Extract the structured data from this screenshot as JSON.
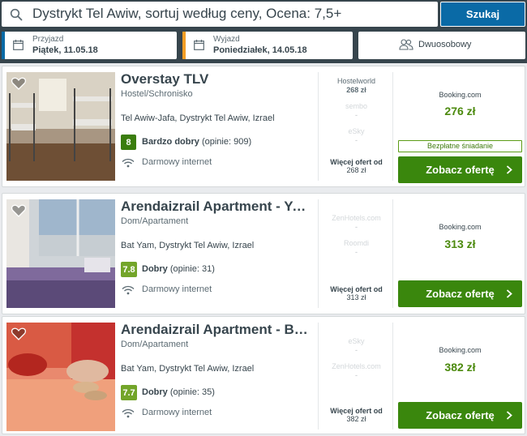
{
  "search": {
    "query": "Dystrykt Tel Awiw, sortuj według ceny, Ocena: 7,5+",
    "button": "Szukaj"
  },
  "checkin": {
    "label": "Przyjazd",
    "value": "Piątek, 11.05.18"
  },
  "checkout": {
    "label": "Wyjazd",
    "value": "Poniedziałek, 14.05.18"
  },
  "room": {
    "label": "Dwuosobowy"
  },
  "colors": {
    "accent_checkin": "#0a6aa6",
    "accent_checkout": "#f49e25",
    "deal_green": "#3a870d",
    "score_dark": "#3a7d0e",
    "score_light": "#73a52a"
  },
  "results": [
    {
      "name": "Overstay TLV",
      "type": "Hostel/Schronisko",
      "location": "Tel Awiw-Jafa, Dystrykt Tel Awiw, Izrael",
      "score": "8",
      "rating_label": "Bardzo dobry",
      "rating_count": "(opinie: 909)",
      "amenity": "Darmowy internet",
      "offers": [
        {
          "site": "Hostelworld",
          "price": "268 zł",
          "ghost": false
        },
        {
          "site": "sembo",
          "price": "-",
          "ghost": true
        },
        {
          "site": "eSky",
          "price": "-",
          "ghost": true
        }
      ],
      "more_label": "Więcej ofert od",
      "more_price": "268 zł",
      "best_site": "Booking.com",
      "best_price": "276 zł",
      "badge": "Bezpłatne śniadanie",
      "cta": "Zobacz ofertę"
    },
    {
      "name": "Arendaizrail Apartment - Yoseftal St.",
      "type": "Dom/Apartament",
      "location": "Bat Yam, Dystrykt Tel Awiw, Izrael",
      "score": "7.8",
      "rating_label": "Dobry",
      "rating_count": "(opinie: 31)",
      "amenity": "Darmowy internet",
      "offers": [
        {
          "site": "ZenHotels.com",
          "price": "-",
          "ghost": true
        },
        {
          "site": "Roomdi",
          "price": "-",
          "ghost": true
        }
      ],
      "more_label": "Więcej ofert od",
      "more_price": "313 zł",
      "best_site": "Booking.com",
      "best_price": "313 zł",
      "badge": "",
      "cta": "Zobacz ofertę"
    },
    {
      "name": "Arendaizrail Apartment - Ben Gurion",
      "type": "Dom/Apartament",
      "location": "Bat Yam, Dystrykt Tel Awiw, Izrael",
      "score": "7.7",
      "rating_label": "Dobry",
      "rating_count": "(opinie: 35)",
      "amenity": "Darmowy internet",
      "offers": [
        {
          "site": "eSky",
          "price": "-",
          "ghost": true
        },
        {
          "site": "ZenHotels.com",
          "price": "-",
          "ghost": true
        }
      ],
      "more_label": "Więcej ofert od",
      "more_price": "382 zł",
      "best_site": "Booking.com",
      "best_price": "382 zł",
      "badge": "",
      "cta": "Zobacz ofertę"
    }
  ]
}
